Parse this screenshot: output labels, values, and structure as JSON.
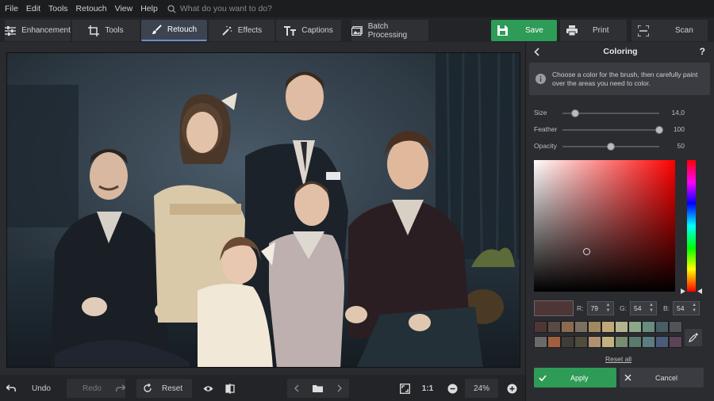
{
  "menu": [
    "File",
    "Edit",
    "Tools",
    "Retouch",
    "View",
    "Help"
  ],
  "search": {
    "placeholder": "What do you want to do?"
  },
  "toolbar": {
    "tabs": [
      {
        "label": "Enhancement",
        "icon": "sliders-icon"
      },
      {
        "label": "Tools",
        "icon": "crop-icon"
      },
      {
        "label": "Retouch",
        "icon": "brush-icon",
        "active": true
      },
      {
        "label": "Effects",
        "icon": "magic-wand-icon"
      },
      {
        "label": "Captions",
        "icon": "text-icon"
      }
    ],
    "batch": "Batch Processing",
    "save": "Save",
    "print": "Print",
    "scan": "Scan"
  },
  "bottom": {
    "undo": "Undo",
    "redo": "Redo",
    "reset": "Reset",
    "ratio": "1:1",
    "zoom": "24%"
  },
  "panel": {
    "title": "Coloring",
    "info": "Choose a color for the brush, then carefully paint over the areas you need to color.",
    "sliders": [
      {
        "label": "Size",
        "value": "14,0",
        "fraction": 0.13
      },
      {
        "label": "Feather",
        "value": "100",
        "fraction": 1.0
      },
      {
        "label": "Opacity",
        "value": "50",
        "fraction": 0.5
      }
    ],
    "rgb": {
      "r_label": "R:",
      "r": "79",
      "g_label": "G:",
      "g": "54",
      "b_label": "B:",
      "b": "54"
    },
    "current_color": "#4f3636",
    "swatches_row1": [
      "#4f3636",
      "#5a4a45",
      "#8c6a50",
      "#7a7060",
      "#a08860",
      "#c0a878",
      "#b4b48c",
      "#8ca888",
      "#688c80",
      "#4a5c64",
      "#505458"
    ],
    "swatches_row2": [
      "#6a6a6a",
      "#a06040",
      "#403c38",
      "#504c3c",
      "#b09070",
      "#c4b080",
      "#788c70",
      "#5a7a6c",
      "#5c7c84",
      "#4a5c7c",
      "#5a4458"
    ],
    "reset_all": "Reset all",
    "apply": "Apply",
    "cancel": "Cancel"
  }
}
